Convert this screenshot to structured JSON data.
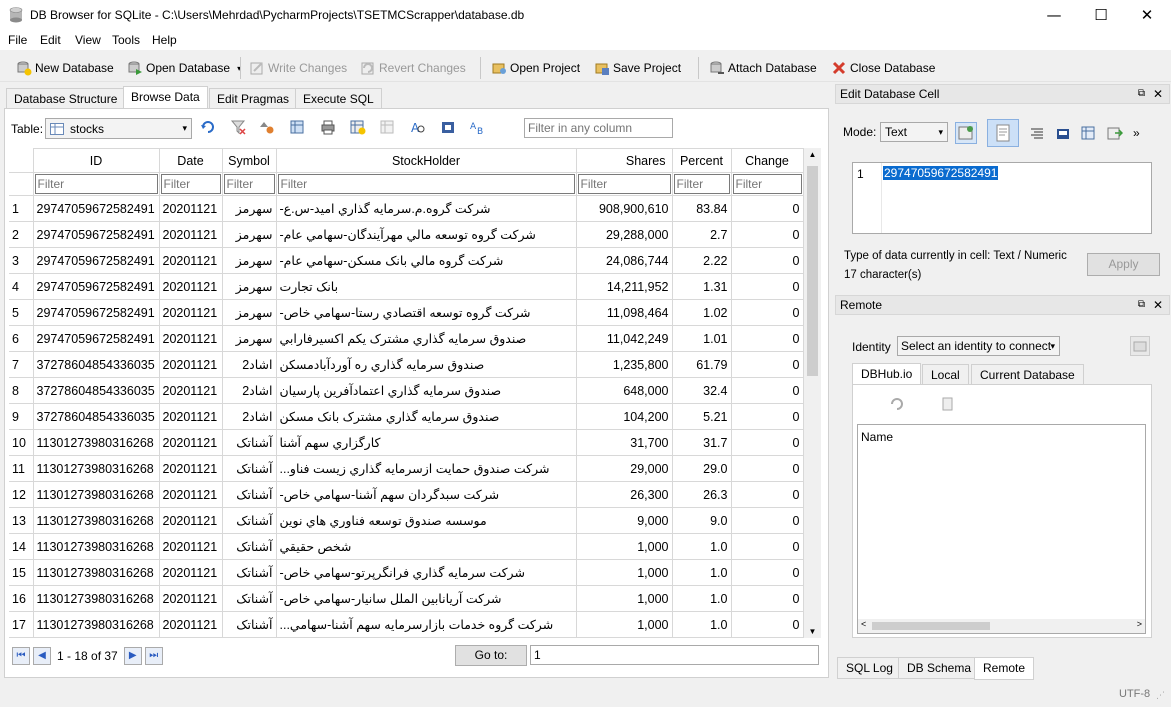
{
  "window": {
    "title": "DB Browser for SQLite - C:\\Users\\Mehrdad\\PycharmProjects\\TSETMCScrapper\\database.db",
    "minimize": "—",
    "maximize": "☐",
    "close": "✕"
  },
  "menu": [
    "File",
    "Edit",
    "View",
    "Tools",
    "Help"
  ],
  "toolbar": {
    "new_db": "New Database",
    "open_db": "Open Database",
    "write": "Write Changes",
    "revert": "Revert Changes",
    "open_proj": "Open Project",
    "save_proj": "Save Project",
    "attach": "Attach Database",
    "close_db": "Close Database"
  },
  "tabs": [
    "Database Structure",
    "Browse Data",
    "Edit Pragmas",
    "Execute SQL"
  ],
  "browse": {
    "table_label": "Table:",
    "table_value": "stocks",
    "filter_placeholder": "Filter in any column"
  },
  "grid": {
    "columns": [
      "ID",
      "Date",
      "Symbol",
      "StockHolder",
      "Shares",
      "Percent",
      "Change"
    ],
    "filter_placeholder": "Filter",
    "rows": [
      [
        "1",
        "29747059672582491",
        "20201121",
        "سهرمز",
        "شرکت گروه.م.سرمايه گذاري اميد-س.ع-",
        "908,900,610",
        "83.84",
        "0"
      ],
      [
        "2",
        "29747059672582491",
        "20201121",
        "سهرمز",
        "شرکت گروه توسعه مالي مهرآيندگان-سهامي عام-",
        "29,288,000",
        "2.7",
        "0"
      ],
      [
        "3",
        "29747059672582491",
        "20201121",
        "سهرمز",
        "شرکت گروه مالي بانک مسکن-سهامي عام-",
        "24,086,744",
        "2.22",
        "0"
      ],
      [
        "4",
        "29747059672582491",
        "20201121",
        "سهرمز",
        "بانک تجارت",
        "14,211,952",
        "1.31",
        "0"
      ],
      [
        "5",
        "29747059672582491",
        "20201121",
        "سهرمز",
        "شرکت گروه توسعه اقتصادي رستا-سهامي خاص-",
        "11,098,464",
        "1.02",
        "0"
      ],
      [
        "6",
        "29747059672582491",
        "20201121",
        "سهرمز",
        "صندوق سرمايه گذاري مشترک يکم اکسيرفارابي",
        "11,042,249",
        "1.01",
        "0"
      ],
      [
        "7",
        "37278604854336035",
        "20201121",
        "اشاد2",
        "صندوق سرمايه گذاري ره آوردآبادمسکن",
        "1,235,800",
        "61.79",
        "0"
      ],
      [
        "8",
        "37278604854336035",
        "20201121",
        "اشاد2",
        "صندوق سرمايه گذاري اعتمادآفرين پارسيان",
        "648,000",
        "32.4",
        "0"
      ],
      [
        "9",
        "37278604854336035",
        "20201121",
        "اشاد2",
        "صندوق سرمايه گذاري مشترک بانک مسکن",
        "104,200",
        "5.21",
        "0"
      ],
      [
        "10",
        "11301273980316268",
        "20201121",
        "آشناتک",
        "کارگزاري سهم آشنا",
        "31,700",
        "31.7",
        "0"
      ],
      [
        "11",
        "11301273980316268",
        "20201121",
        "آشناتک",
        "شرکت صندوق حمايت ازسرمايه گذاري زيست فناو...",
        "29,000",
        "29.0",
        "0"
      ],
      [
        "12",
        "11301273980316268",
        "20201121",
        "آشناتک",
        "شرکت سبدگردان سهم آشنا-سهامي خاص-",
        "26,300",
        "26.3",
        "0"
      ],
      [
        "13",
        "11301273980316268",
        "20201121",
        "آشناتک",
        "موسسه صندوق توسعه فناوري هاي نوين",
        "9,000",
        "9.0",
        "0"
      ],
      [
        "14",
        "11301273980316268",
        "20201121",
        "آشناتک",
        "شخص حقيقي",
        "1,000",
        "1.0",
        "0"
      ],
      [
        "15",
        "11301273980316268",
        "20201121",
        "آشناتک",
        "شرکت سرمايه گذاري فرانگرپرتو-سهامي خاص-",
        "1,000",
        "1.0",
        "0"
      ],
      [
        "16",
        "11301273980316268",
        "20201121",
        "آشناتک",
        "شرکت آريانابين الملل سانيار-سهامي خاص-",
        "1,000",
        "1.0",
        "0"
      ],
      [
        "17",
        "11301273980316268",
        "20201121",
        "آشناتک",
        "شرکت گروه خدمات بازارسرمايه سهم آشنا-سهامي...",
        "1,000",
        "1.0",
        "0"
      ]
    ]
  },
  "nav": {
    "range": "1 - 18 of 37",
    "goto_label": "Go to:",
    "goto_value": "1"
  },
  "edit_cell": {
    "title": "Edit Database Cell",
    "mode_label": "Mode:",
    "mode_value": "Text",
    "line_no": "1",
    "value": "29747059672582491",
    "type_info": "Type of data currently in cell: Text / Numeric",
    "char_count": "17 character(s)",
    "apply": "Apply"
  },
  "remote": {
    "title": "Remote",
    "identity_label": "Identity",
    "identity_value": "Select an identity to connect",
    "tabs": [
      "DBHub.io",
      "Local",
      "Current Database"
    ],
    "name_header": "Name"
  },
  "bottom_tabs": [
    "SQL Log",
    "DB Schema",
    "Remote"
  ],
  "status": {
    "encoding": "UTF-8"
  }
}
